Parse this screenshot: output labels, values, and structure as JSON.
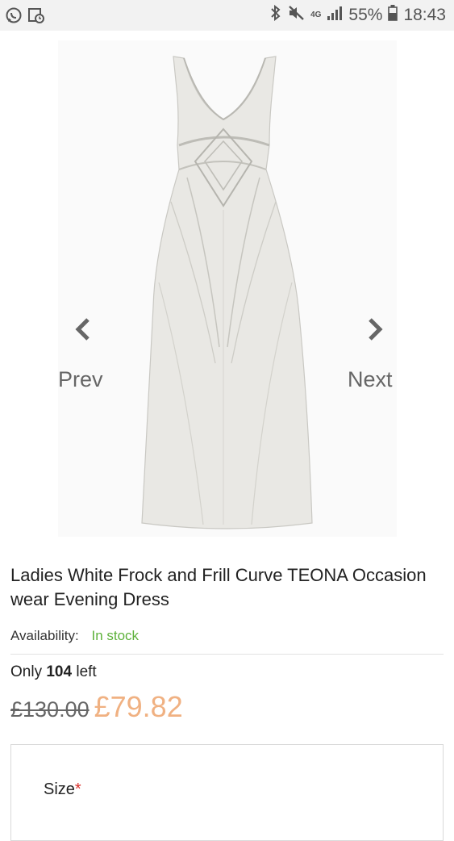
{
  "status_bar": {
    "network": "4G",
    "battery": "55%",
    "time": "18:43",
    "icons": [
      "whatsapp-icon",
      "calendar-icon",
      "bluetooth-icon",
      "mute-icon",
      "signal-icon",
      "battery-icon"
    ]
  },
  "gallery": {
    "prev_label": "Prev",
    "next_label": "Next"
  },
  "product": {
    "title": "Ladies White Frock and Frill Curve TEONA Occasion wear Evening Dress",
    "availability_label": "Availability:",
    "availability_value": "In stock",
    "stock_prefix": "Only",
    "stock_count": "104",
    "stock_suffix": "left",
    "old_price": "£130.00",
    "new_price": "£79.82"
  },
  "options": {
    "size_label": "Size",
    "required_mark": "*"
  },
  "colors": {
    "in_stock": "#5db13a",
    "sale_price": "#f0b182",
    "required": "#d9302b"
  }
}
